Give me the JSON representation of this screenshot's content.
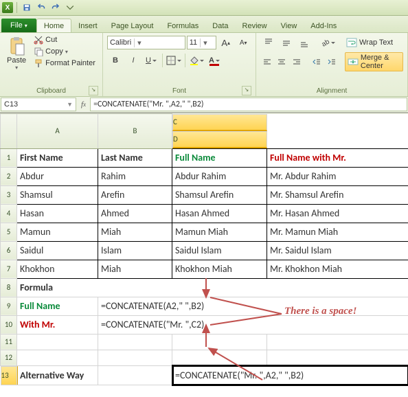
{
  "qat": {
    "save": "save",
    "undo": "undo",
    "redo": "redo"
  },
  "tabs": {
    "file": "File",
    "home": "Home",
    "insert": "Insert",
    "pagelayout": "Page Layout",
    "formulas": "Formulas",
    "data": "Data",
    "review": "Review",
    "view": "View",
    "addins": "Add-Ins"
  },
  "ribbon": {
    "clipboard": {
      "label": "Clipboard",
      "paste": "Paste",
      "cut": "Cut",
      "copy": "Copy",
      "format": "Format Painter"
    },
    "font": {
      "label": "Font",
      "name": "Calibri",
      "size": "11"
    },
    "alignment": {
      "label": "Alignment",
      "wrap": "Wrap Text",
      "merge": "Merge & Center"
    }
  },
  "namebox": "C13",
  "formula": "=CONCATENATE(\"Mr. \",A2,\" \",B2)",
  "cols": [
    "A",
    "B",
    "C",
    "D"
  ],
  "rows": [
    "1",
    "2",
    "3",
    "4",
    "5",
    "6",
    "7",
    "8",
    "9",
    "10",
    "11",
    "12",
    "13"
  ],
  "data": {
    "A1": "First Name",
    "B1": "Last Name",
    "C1": "Full Name",
    "D1": "Full Name with Mr.",
    "A2": "Abdur",
    "B2": "Rahim",
    "C2": "Abdur Rahim",
    "D2": "Mr. Abdur Rahim",
    "A3": "Shamsul",
    "B3": "Arefin",
    "C3": "Shamsul Arefin",
    "D3": "Mr. Shamsul Arefin",
    "A4": "Hasan",
    "B4": "Ahmed",
    "C4": "Hasan Ahmed",
    "D4": "Mr. Hasan Ahmed",
    "A5": "Mamun",
    "B5": "Miah",
    "C5": "Mamun Miah",
    "D5": "Mr. Mamun Miah",
    "A6": "Saidul",
    "B6": "Islam",
    "C6": "Saidul Islam",
    "D6": "Mr. Saidul Islam",
    "A7": "Khokhon",
    "B7": "Miah",
    "C7": "Khokhon  Miah",
    "D7": "Mr. Khokhon  Miah",
    "A8": "Formula",
    "A9": "Full Name",
    "B9": "=CONCATENATE(A2,\" \",B2)",
    "A10": "With Mr.",
    "B10": "=CONCATENATE(\"Mr. \",C2)",
    "A13": "Alternative Way",
    "C13": "=CONCATENATE(\"Mr. \",A2,\" \",B2)"
  },
  "annotation": "There is a space!"
}
